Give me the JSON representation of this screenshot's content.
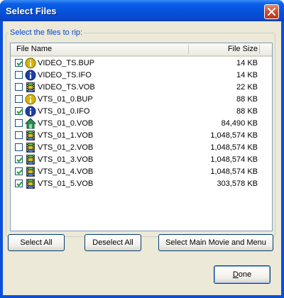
{
  "window": {
    "title": "Select Files",
    "close_icon": "close-icon"
  },
  "group": {
    "label": "Select the files to rip:"
  },
  "list": {
    "columns": {
      "name": "File Name",
      "size": "File Size"
    },
    "rows": [
      {
        "name": "VIDEO_TS.BUP",
        "size": "14 KB",
        "checked": true,
        "icon": "info-yellow-icon"
      },
      {
        "name": "VIDEO_TS.IFO",
        "size": "14 KB",
        "checked": false,
        "icon": "info-blue-icon"
      },
      {
        "name": "VIDEO_TS.VOB",
        "size": "22 KB",
        "checked": false,
        "icon": "film-icon"
      },
      {
        "name": "VTS_01_0.BUP",
        "size": "88 KB",
        "checked": false,
        "icon": "info-yellow-icon"
      },
      {
        "name": "VTS_01_0.IFO",
        "size": "88 KB",
        "checked": true,
        "icon": "info-blue-icon"
      },
      {
        "name": "VTS_01_0.VOB",
        "size": "84,490 KB",
        "checked": false,
        "icon": "menu-house-icon"
      },
      {
        "name": "VTS_01_1.VOB",
        "size": "1,048,574 KB",
        "checked": false,
        "icon": "film-icon"
      },
      {
        "name": "VTS_01_2.VOB",
        "size": "1,048,574 KB",
        "checked": false,
        "icon": "film-icon"
      },
      {
        "name": "VTS_01_3.VOB",
        "size": "1,048,574 KB",
        "checked": true,
        "icon": "film-icon"
      },
      {
        "name": "VTS_01_4.VOB",
        "size": "1,048,574 KB",
        "checked": true,
        "icon": "film-icon"
      },
      {
        "name": "VTS_01_5.VOB",
        "size": "303,578 KB",
        "checked": true,
        "icon": "film-icon"
      }
    ]
  },
  "buttons": {
    "select_all": "Select All",
    "deselect_all": "Deselect All",
    "select_main": "Select Main Movie and Menu",
    "done_mnemonic": "D",
    "done_rest": "one"
  },
  "colors": {
    "titlebar": "#0552dc",
    "face": "#ece9d8",
    "group_label": "#0046d5",
    "close": "#c9452a"
  }
}
